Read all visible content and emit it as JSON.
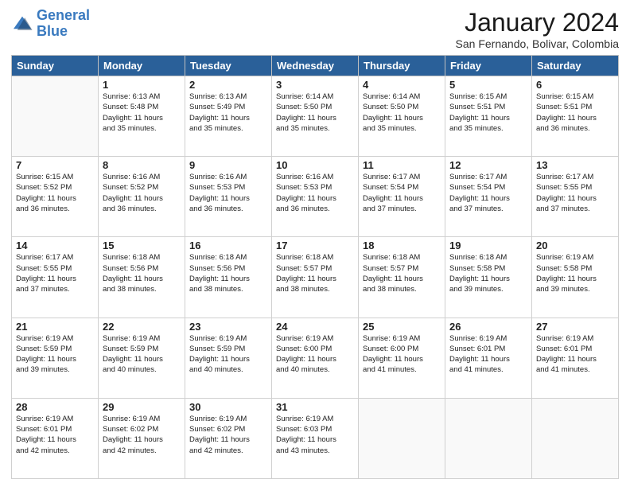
{
  "logo": {
    "line1": "General",
    "line2": "Blue"
  },
  "title": "January 2024",
  "subtitle": "San Fernando, Bolivar, Colombia",
  "days_of_week": [
    "Sunday",
    "Monday",
    "Tuesday",
    "Wednesday",
    "Thursday",
    "Friday",
    "Saturday"
  ],
  "weeks": [
    [
      {
        "day": "",
        "info": ""
      },
      {
        "day": "1",
        "info": "Sunrise: 6:13 AM\nSunset: 5:48 PM\nDaylight: 11 hours\nand 35 minutes."
      },
      {
        "day": "2",
        "info": "Sunrise: 6:13 AM\nSunset: 5:49 PM\nDaylight: 11 hours\nand 35 minutes."
      },
      {
        "day": "3",
        "info": "Sunrise: 6:14 AM\nSunset: 5:50 PM\nDaylight: 11 hours\nand 35 minutes."
      },
      {
        "day": "4",
        "info": "Sunrise: 6:14 AM\nSunset: 5:50 PM\nDaylight: 11 hours\nand 35 minutes."
      },
      {
        "day": "5",
        "info": "Sunrise: 6:15 AM\nSunset: 5:51 PM\nDaylight: 11 hours\nand 35 minutes."
      },
      {
        "day": "6",
        "info": "Sunrise: 6:15 AM\nSunset: 5:51 PM\nDaylight: 11 hours\nand 36 minutes."
      }
    ],
    [
      {
        "day": "7",
        "info": "Sunrise: 6:15 AM\nSunset: 5:52 PM\nDaylight: 11 hours\nand 36 minutes."
      },
      {
        "day": "8",
        "info": "Sunrise: 6:16 AM\nSunset: 5:52 PM\nDaylight: 11 hours\nand 36 minutes."
      },
      {
        "day": "9",
        "info": "Sunrise: 6:16 AM\nSunset: 5:53 PM\nDaylight: 11 hours\nand 36 minutes."
      },
      {
        "day": "10",
        "info": "Sunrise: 6:16 AM\nSunset: 5:53 PM\nDaylight: 11 hours\nand 36 minutes."
      },
      {
        "day": "11",
        "info": "Sunrise: 6:17 AM\nSunset: 5:54 PM\nDaylight: 11 hours\nand 37 minutes."
      },
      {
        "day": "12",
        "info": "Sunrise: 6:17 AM\nSunset: 5:54 PM\nDaylight: 11 hours\nand 37 minutes."
      },
      {
        "day": "13",
        "info": "Sunrise: 6:17 AM\nSunset: 5:55 PM\nDaylight: 11 hours\nand 37 minutes."
      }
    ],
    [
      {
        "day": "14",
        "info": "Sunrise: 6:17 AM\nSunset: 5:55 PM\nDaylight: 11 hours\nand 37 minutes."
      },
      {
        "day": "15",
        "info": "Sunrise: 6:18 AM\nSunset: 5:56 PM\nDaylight: 11 hours\nand 38 minutes."
      },
      {
        "day": "16",
        "info": "Sunrise: 6:18 AM\nSunset: 5:56 PM\nDaylight: 11 hours\nand 38 minutes."
      },
      {
        "day": "17",
        "info": "Sunrise: 6:18 AM\nSunset: 5:57 PM\nDaylight: 11 hours\nand 38 minutes."
      },
      {
        "day": "18",
        "info": "Sunrise: 6:18 AM\nSunset: 5:57 PM\nDaylight: 11 hours\nand 38 minutes."
      },
      {
        "day": "19",
        "info": "Sunrise: 6:18 AM\nSunset: 5:58 PM\nDaylight: 11 hours\nand 39 minutes."
      },
      {
        "day": "20",
        "info": "Sunrise: 6:19 AM\nSunset: 5:58 PM\nDaylight: 11 hours\nand 39 minutes."
      }
    ],
    [
      {
        "day": "21",
        "info": "Sunrise: 6:19 AM\nSunset: 5:59 PM\nDaylight: 11 hours\nand 39 minutes."
      },
      {
        "day": "22",
        "info": "Sunrise: 6:19 AM\nSunset: 5:59 PM\nDaylight: 11 hours\nand 40 minutes."
      },
      {
        "day": "23",
        "info": "Sunrise: 6:19 AM\nSunset: 5:59 PM\nDaylight: 11 hours\nand 40 minutes."
      },
      {
        "day": "24",
        "info": "Sunrise: 6:19 AM\nSunset: 6:00 PM\nDaylight: 11 hours\nand 40 minutes."
      },
      {
        "day": "25",
        "info": "Sunrise: 6:19 AM\nSunset: 6:00 PM\nDaylight: 11 hours\nand 41 minutes."
      },
      {
        "day": "26",
        "info": "Sunrise: 6:19 AM\nSunset: 6:01 PM\nDaylight: 11 hours\nand 41 minutes."
      },
      {
        "day": "27",
        "info": "Sunrise: 6:19 AM\nSunset: 6:01 PM\nDaylight: 11 hours\nand 41 minutes."
      }
    ],
    [
      {
        "day": "28",
        "info": "Sunrise: 6:19 AM\nSunset: 6:01 PM\nDaylight: 11 hours\nand 42 minutes."
      },
      {
        "day": "29",
        "info": "Sunrise: 6:19 AM\nSunset: 6:02 PM\nDaylight: 11 hours\nand 42 minutes."
      },
      {
        "day": "30",
        "info": "Sunrise: 6:19 AM\nSunset: 6:02 PM\nDaylight: 11 hours\nand 42 minutes."
      },
      {
        "day": "31",
        "info": "Sunrise: 6:19 AM\nSunset: 6:03 PM\nDaylight: 11 hours\nand 43 minutes."
      },
      {
        "day": "",
        "info": ""
      },
      {
        "day": "",
        "info": ""
      },
      {
        "day": "",
        "info": ""
      }
    ]
  ]
}
